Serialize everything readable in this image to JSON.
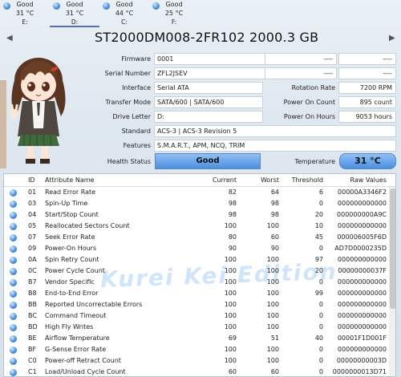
{
  "drives": [
    {
      "status": "Good",
      "temp": "31 °C",
      "letter": "E:"
    },
    {
      "status": "Good",
      "temp": "31 °C",
      "letter": "D:"
    },
    {
      "status": "Good",
      "temp": "44 °C",
      "letter": "C:"
    },
    {
      "status": "Good",
      "temp": "25 °C",
      "letter": "F:"
    }
  ],
  "nav": {
    "prev": "◀",
    "next": "▶"
  },
  "model": "ST2000DM008-2FR102 2000.3 GB",
  "info": {
    "firmware_label": "Firmware",
    "firmware": "0001",
    "serial_label": "Serial Number",
    "serial": "ZFL2JSEV",
    "interface_label": "Interface",
    "interface": "Serial ATA",
    "transfer_label": "Transfer Mode",
    "transfer": "SATA/600 | SATA/600",
    "drive_letter_label": "Drive Letter",
    "drive_letter": "D:",
    "standard_label": "Standard",
    "standard": "ACS-3 | ACS-3 Revision 5",
    "features_label": "Features",
    "features": "S.M.A.R.T., APM, NCQ, TRIM",
    "health_label": "Health Status",
    "health": "Good",
    "temperature_label": "Temperature",
    "temperature": "31 °C",
    "right_top1": "----",
    "right_top1v": "----",
    "right_top2": "----",
    "right_top2v": "----",
    "rotation_label": "Rotation Rate",
    "rotation": "7200 RPM",
    "power_count_label": "Power On Count",
    "power_count": "895 count",
    "power_hours_label": "Power On Hours",
    "power_hours": "9053 hours"
  },
  "table": {
    "headers": {
      "id": "ID",
      "attr": "Attribute Name",
      "current": "Current",
      "worst": "Worst",
      "threshold": "Threshold",
      "raw": "Raw Values"
    },
    "rows": [
      {
        "id": "01",
        "name": "Read Error Rate",
        "current": "82",
        "worst": "64",
        "threshold": "6",
        "raw": "00000A3346F2"
      },
      {
        "id": "03",
        "name": "Spin-Up Time",
        "current": "98",
        "worst": "98",
        "threshold": "0",
        "raw": "000000000000"
      },
      {
        "id": "04",
        "name": "Start/Stop Count",
        "current": "98",
        "worst": "98",
        "threshold": "20",
        "raw": "000000000A9C"
      },
      {
        "id": "05",
        "name": "Reallocated Sectors Count",
        "current": "100",
        "worst": "100",
        "threshold": "10",
        "raw": "000000000000"
      },
      {
        "id": "07",
        "name": "Seek Error Rate",
        "current": "80",
        "worst": "60",
        "threshold": "45",
        "raw": "000006005F6D"
      },
      {
        "id": "09",
        "name": "Power-On Hours",
        "current": "90",
        "worst": "90",
        "threshold": "0",
        "raw": "AD7D0000235D"
      },
      {
        "id": "0A",
        "name": "Spin Retry Count",
        "current": "100",
        "worst": "100",
        "threshold": "97",
        "raw": "000000000000"
      },
      {
        "id": "0C",
        "name": "Power Cycle Count",
        "current": "100",
        "worst": "100",
        "threshold": "20",
        "raw": "00000000037F"
      },
      {
        "id": "B7",
        "name": "Vendor Specific",
        "current": "100",
        "worst": "100",
        "threshold": "0",
        "raw": "000000000000"
      },
      {
        "id": "B8",
        "name": "End-to-End Error",
        "current": "100",
        "worst": "100",
        "threshold": "99",
        "raw": "000000000000"
      },
      {
        "id": "BB",
        "name": "Reported Uncorrectable Errors",
        "current": "100",
        "worst": "100",
        "threshold": "0",
        "raw": "000000000000"
      },
      {
        "id": "BC",
        "name": "Command Timeout",
        "current": "100",
        "worst": "100",
        "threshold": "0",
        "raw": "000000000000"
      },
      {
        "id": "BD",
        "name": "High Fly Writes",
        "current": "100",
        "worst": "100",
        "threshold": "0",
        "raw": "000000000000"
      },
      {
        "id": "BE",
        "name": "Airflow Temperature",
        "current": "69",
        "worst": "51",
        "threshold": "40",
        "raw": "00001F1D001F"
      },
      {
        "id": "BF",
        "name": "G-Sense Error Rate",
        "current": "100",
        "worst": "100",
        "threshold": "0",
        "raw": "000000000000"
      },
      {
        "id": "C0",
        "name": "Power-off Retract Count",
        "current": "100",
        "worst": "100",
        "threshold": "0",
        "raw": "00000000003D"
      },
      {
        "id": "C1",
        "name": "Load/Unload Cycle Count",
        "current": "60",
        "worst": "60",
        "threshold": "0",
        "raw": "0000000013D71"
      }
    ]
  },
  "watermark": "Kurei Kei Edition",
  "colors": {
    "accent": "#4d8ee0",
    "good": "#4f94dc"
  }
}
